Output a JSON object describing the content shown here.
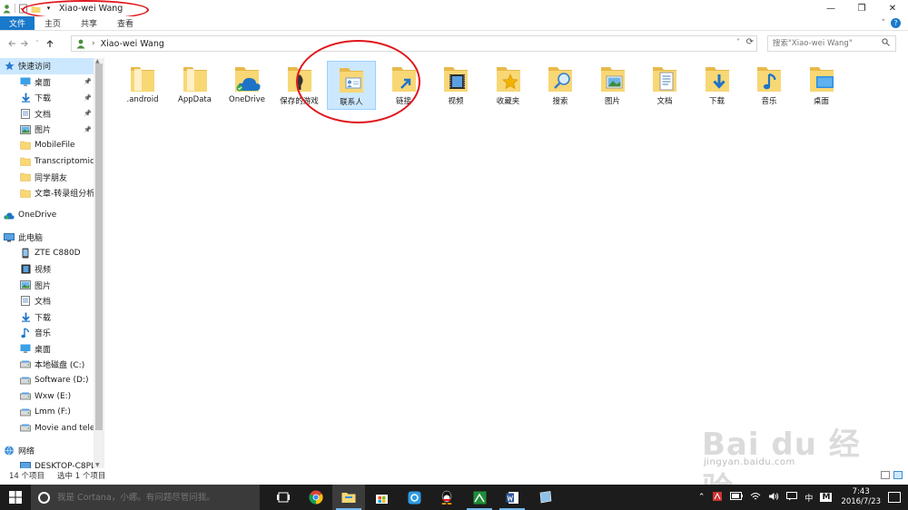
{
  "window": {
    "title": "Xiao-wei Wang",
    "controls": {
      "minimize": "—",
      "restore": "❐",
      "close": "✕"
    }
  },
  "ribbon": {
    "tabs": [
      "文件",
      "主页",
      "共享",
      "查看"
    ],
    "chevron": "˅",
    "help": "?"
  },
  "address": {
    "path": "Xiao-wei Wang",
    "search_placeholder": "搜索\"Xiao-wei Wang\""
  },
  "nav": {
    "quick_access": "快速访问",
    "quick_items": [
      {
        "label": "桌面",
        "icon": "desktop-icon",
        "pinned": true
      },
      {
        "label": "下载",
        "icon": "download-icon",
        "pinned": true
      },
      {
        "label": "文档",
        "icon": "documents-icon",
        "pinned": true
      },
      {
        "label": "图片",
        "icon": "pictures-icon",
        "pinned": true
      },
      {
        "label": "MobileFile",
        "icon": "folder-icon",
        "pinned": false
      },
      {
        "label": "Transcriptomic",
        "icon": "folder-icon",
        "pinned": false
      },
      {
        "label": "同学朋友",
        "icon": "folder-icon",
        "pinned": false
      },
      {
        "label": "文章-转录组分析",
        "icon": "folder-icon",
        "pinned": false
      }
    ],
    "onedrive": "OneDrive",
    "this_pc": "此电脑",
    "pc_items": [
      {
        "label": "ZTE C880D",
        "icon": "phone-icon"
      },
      {
        "label": "视频",
        "icon": "videos-icon"
      },
      {
        "label": "图片",
        "icon": "pictures-icon"
      },
      {
        "label": "文档",
        "icon": "documents-icon"
      },
      {
        "label": "下载",
        "icon": "download-icon"
      },
      {
        "label": "音乐",
        "icon": "music-icon"
      },
      {
        "label": "桌面",
        "icon": "desktop-icon"
      },
      {
        "label": "本地磁盘 (C:)",
        "icon": "drive-icon"
      },
      {
        "label": "Software (D:)",
        "icon": "drive-icon"
      },
      {
        "label": "Wxw (E:)",
        "icon": "drive-icon"
      },
      {
        "label": "Lmm (F:)",
        "icon": "drive-icon"
      },
      {
        "label": "Movie and tele",
        "icon": "drive-icon"
      }
    ],
    "network": "网络",
    "network_items": [
      {
        "label": "DESKTOP-C8PL",
        "icon": "computer-icon"
      }
    ]
  },
  "files": [
    {
      "label": ".android",
      "icon": "folder-icon",
      "selected": false
    },
    {
      "label": "AppData",
      "icon": "folder-icon",
      "selected": false
    },
    {
      "label": "OneDrive",
      "icon": "onedrive-folder-icon",
      "selected": false
    },
    {
      "label": "保存的游戏",
      "icon": "saved-games-icon",
      "selected": false
    },
    {
      "label": "联系人",
      "icon": "contacts-icon",
      "selected": true
    },
    {
      "label": "链接",
      "icon": "links-icon",
      "selected": false
    },
    {
      "label": "视频",
      "icon": "videos-folder-icon",
      "selected": false
    },
    {
      "label": "收藏夹",
      "icon": "favorites-icon",
      "selected": false
    },
    {
      "label": "搜索",
      "icon": "searches-icon",
      "selected": false
    },
    {
      "label": "图片",
      "icon": "pictures-folder-icon",
      "selected": false
    },
    {
      "label": "文档",
      "icon": "documents-folder-icon",
      "selected": false
    },
    {
      "label": "下载",
      "icon": "downloads-folder-icon",
      "selected": false
    },
    {
      "label": "音乐",
      "icon": "music-folder-icon",
      "selected": false
    },
    {
      "label": "桌面",
      "icon": "desktop-folder-icon",
      "selected": false
    }
  ],
  "status": {
    "item_count": "14 个项目",
    "selected_count": "选中 1 个项目"
  },
  "taskbar": {
    "cortana_placeholder": "我是 Cortana，小娜。有问题尽管问我。",
    "ime": "中",
    "ime_mode": "M",
    "time": "7:43",
    "date": "2016/7/23"
  },
  "watermark": {
    "brand": "Bai du 经验",
    "url": "jingyan.baidu.com"
  },
  "colors": {
    "accent": "#1979ca",
    "selection": "#cce8ff",
    "folder": "#f8d775",
    "annotation": "#e0161c"
  }
}
